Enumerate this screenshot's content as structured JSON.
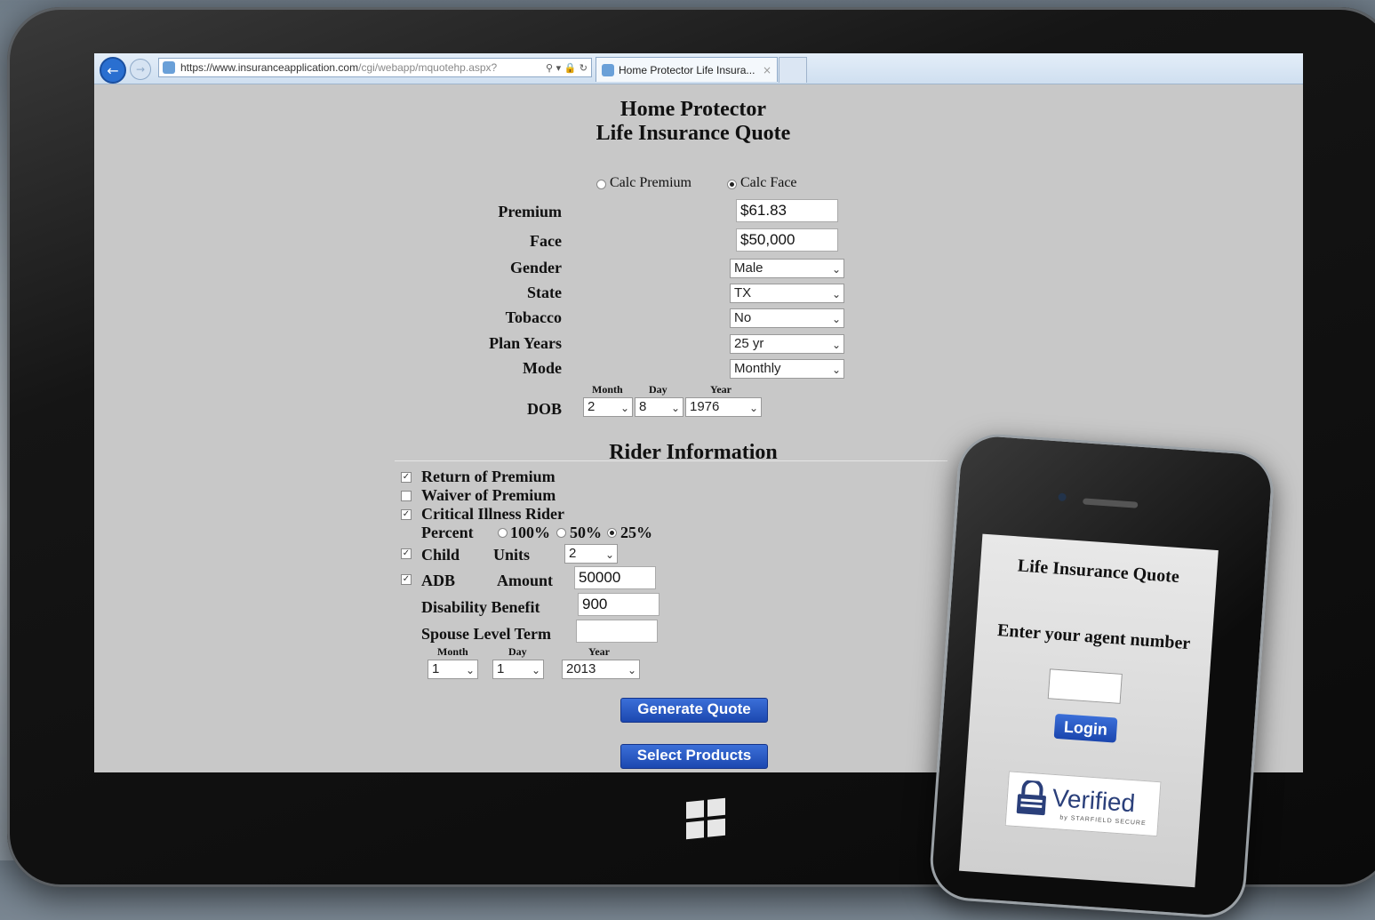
{
  "browser": {
    "url_main": "https://www.insuranceapplication.com",
    "url_rest": "/cgi/webapp/mquotehp.aspx?",
    "tab_title": "Home Protector Life Insura...",
    "tab_close": "×"
  },
  "page": {
    "title_line1": "Home Protector",
    "title_line2": "Life Insurance Quote",
    "calc_options": [
      "Calc Premium",
      "Calc Face"
    ],
    "calc_selected": "Calc Face",
    "fields": {
      "premium_label": "Premium",
      "premium_value": "$61.83",
      "face_label": "Face",
      "face_value": "$50,000",
      "gender_label": "Gender",
      "gender_value": "Male",
      "state_label": "State",
      "state_value": "TX",
      "tobacco_label": "Tobacco",
      "tobacco_value": "No",
      "plan_years_label": "Plan Years",
      "plan_years_value": "25 yr",
      "mode_label": "Mode",
      "mode_value": "Monthly",
      "dob_label": "DOB",
      "month_header": "Month",
      "day_header": "Day",
      "year_header": "Year",
      "dob_month": "2",
      "dob_day": "8",
      "dob_year": "1976"
    },
    "rider": {
      "heading": "Rider Information",
      "return_of_premium": "Return of Premium",
      "return_of_premium_checked": true,
      "waiver_of_premium": "Waiver of Premium",
      "waiver_of_premium_checked": false,
      "critical_illness": "Critical Illness Rider",
      "critical_illness_checked": true,
      "percent_label": "Percent",
      "percent_options": [
        "100%",
        "50%",
        "25%"
      ],
      "percent_selected": "25%",
      "child_label": "Child",
      "child_checked": true,
      "units_label": "Units",
      "units_value": "2",
      "adb_label": "ADB",
      "adb_checked": true,
      "amount_label": "Amount",
      "amount_value": "50000",
      "disability_label": "Disability Benefit",
      "disability_value": "900",
      "spouse_label": "Spouse Level Term",
      "spouse_value": "",
      "spouse_month": "1",
      "spouse_day": "1",
      "spouse_year": "2013"
    },
    "buttons": {
      "generate": "Generate Quote",
      "select": "Select Products"
    }
  },
  "phone": {
    "title": "Life Insurance Quote",
    "prompt": "Enter your agent number",
    "login": "Login",
    "badge_text": "Verified",
    "badge_sub": "by STARFIELD SECURE"
  },
  "icons": {
    "back": "back-arrow-icon",
    "forward": "forward-arrow-icon",
    "windows": "windows-logo-icon",
    "lock": "lock-icon"
  }
}
